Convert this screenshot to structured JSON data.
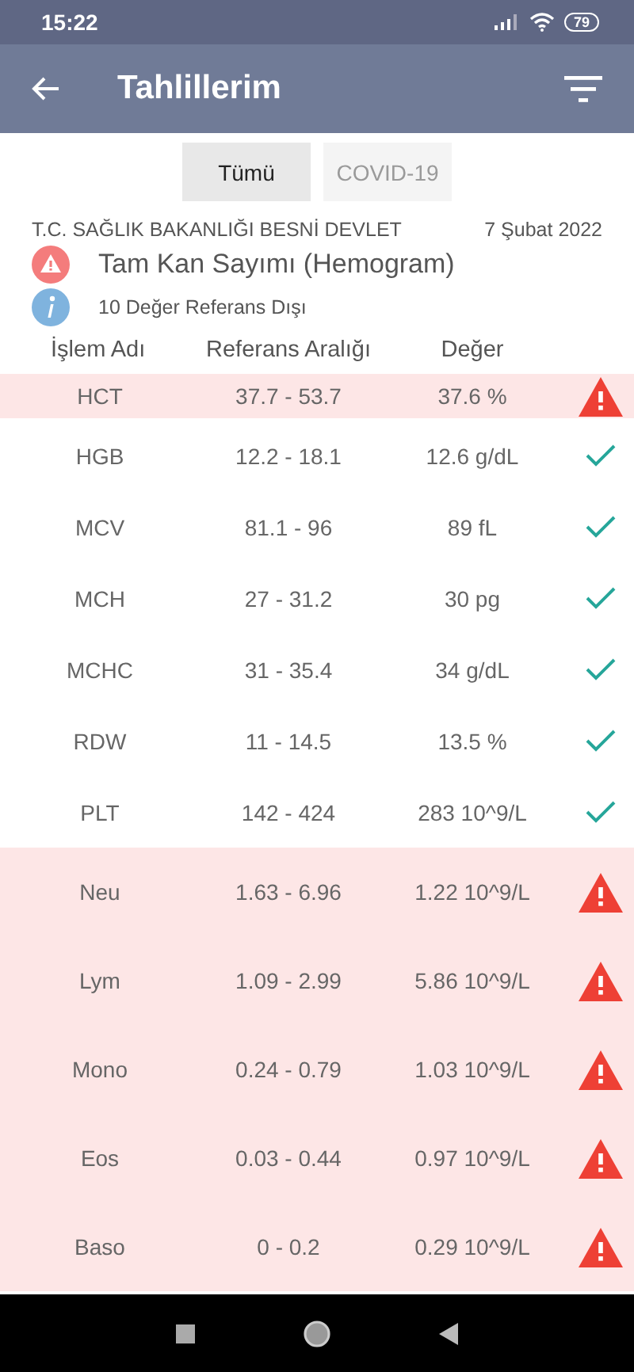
{
  "status_bar": {
    "time": "15:22",
    "battery": "79"
  },
  "app_bar": {
    "title": "Tahlillerim"
  },
  "tabs": [
    {
      "label": "Tümü",
      "selected": true
    },
    {
      "label": "COVID-19",
      "selected": false
    }
  ],
  "report": {
    "institution": "T.C. SAĞLIK BAKANLIĞI BESNİ DEVLET",
    "date": "7 Şubat 2022",
    "test_name": "Tam Kan Sayımı (Hemogram)",
    "summary": "10 Değer Referans Dışı"
  },
  "table": {
    "columns": [
      "İşlem Adı",
      "Referans Aralığı",
      "Değer"
    ],
    "rows": [
      {
        "name": "HCT",
        "range": "37.7 - 53.7",
        "value": "37.6 %",
        "out_of_range": true
      },
      {
        "name": "HGB",
        "range": "12.2 - 18.1",
        "value": "12.6 g/dL",
        "out_of_range": false
      },
      {
        "name": "MCV",
        "range": "81.1 - 96",
        "value": "89 fL",
        "out_of_range": false
      },
      {
        "name": "MCH",
        "range": "27 - 31.2",
        "value": "30 pg",
        "out_of_range": false
      },
      {
        "name": "MCHC",
        "range": "31 - 35.4",
        "value": "34 g/dL",
        "out_of_range": false
      },
      {
        "name": "RDW",
        "range": "11 - 14.5",
        "value": "13.5 %",
        "out_of_range": false
      },
      {
        "name": "PLT",
        "range": "142 - 424",
        "value": "283 10^9/L",
        "out_of_range": false
      },
      {
        "name": "Neu",
        "range": "1.63 - 6.96",
        "value": "1.22 10^9/L",
        "out_of_range": true
      },
      {
        "name": "Lym",
        "range": "1.09 - 2.99",
        "value": "5.86 10^9/L",
        "out_of_range": true
      },
      {
        "name": "Mono",
        "range": "0.24 - 0.79",
        "value": "1.03 10^9/L",
        "out_of_range": true
      },
      {
        "name": "Eos",
        "range": "0.03 - 0.44",
        "value": "0.97 10^9/L",
        "out_of_range": true
      },
      {
        "name": "Baso",
        "range": "0 - 0.2",
        "value": "0.29 10^9/L",
        "out_of_range": true
      }
    ]
  }
}
